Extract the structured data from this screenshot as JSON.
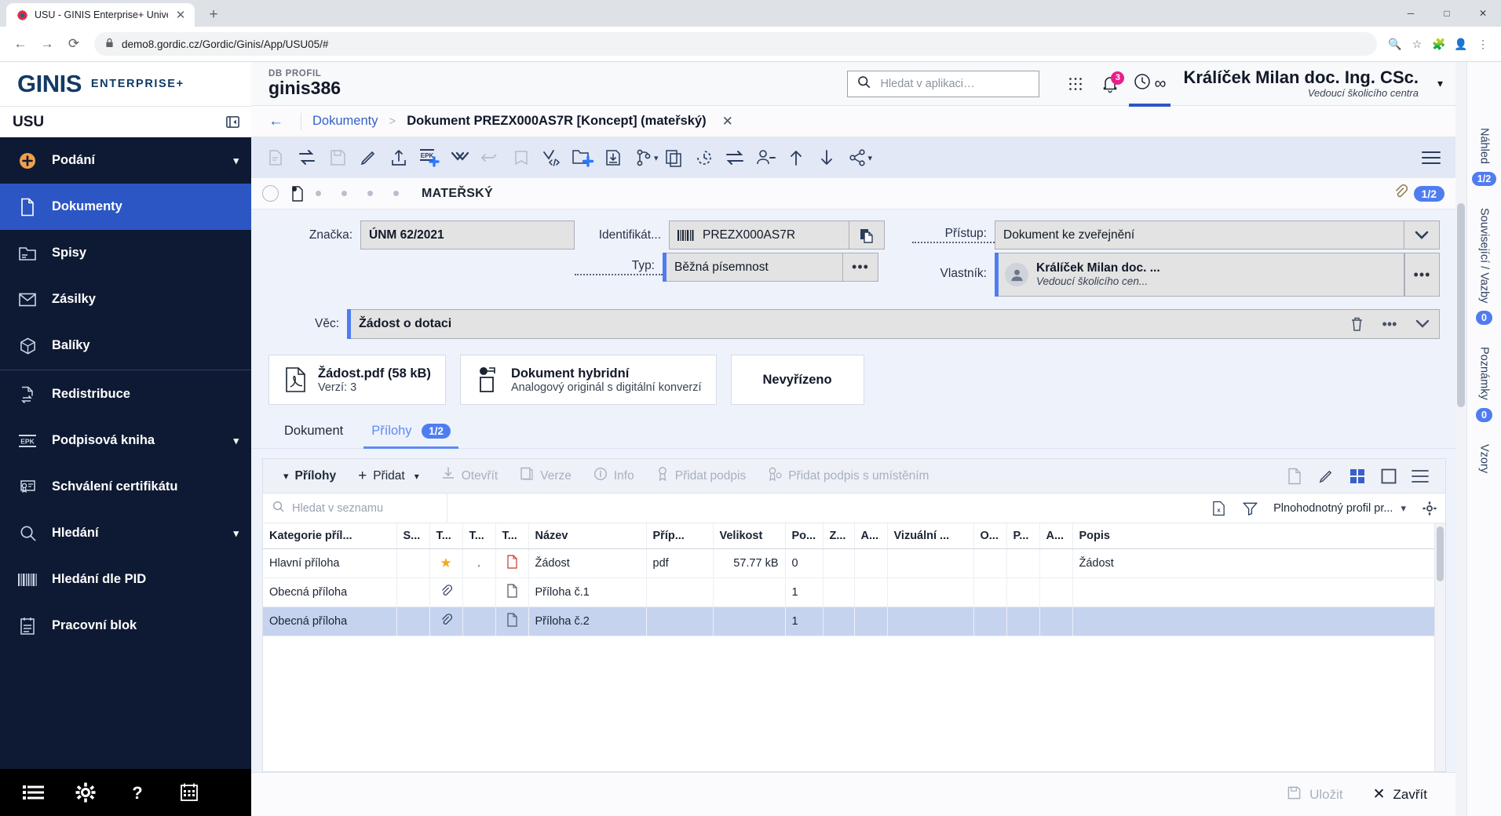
{
  "browser": {
    "tab_title": "USU - GINIS Enterprise+ Univerz",
    "new_tab_label": "+",
    "url": "demo8.gordic.cz/Gordic/Ginis/App/USU05/#",
    "minimize": "─",
    "maximize": "□",
    "close": "✕"
  },
  "sidebar": {
    "brand_primary": "GINIS",
    "brand_secondary": "ENTERPRISE+",
    "module": "USU",
    "items": [
      {
        "label": "Podání",
        "icon": "plus-circle-icon",
        "chevron": true,
        "active": false
      },
      {
        "label": "Dokumenty",
        "icon": "document-icon",
        "chevron": false,
        "active": true
      },
      {
        "label": "Spisy",
        "icon": "folder-icon",
        "chevron": false,
        "active": false
      },
      {
        "label": "Zásilky",
        "icon": "envelope-icon",
        "chevron": false,
        "active": false
      },
      {
        "label": "Balíky",
        "icon": "box-icon",
        "chevron": false,
        "active": false
      },
      {
        "label": "Redistribuce",
        "icon": "redistribute-icon",
        "chevron": false,
        "active": false
      },
      {
        "label": "Podpisová kniha",
        "icon": "epk-icon",
        "chevron": true,
        "active": false
      },
      {
        "label": "Schválení certifikátu",
        "icon": "certificate-icon",
        "chevron": false,
        "active": false
      },
      {
        "label": "Hledání",
        "icon": "search-icon",
        "chevron": true,
        "active": false
      },
      {
        "label": "Hledání dle PID",
        "icon": "barcode-icon",
        "chevron": false,
        "active": false
      },
      {
        "label": "Pracovní blok",
        "icon": "notepad-icon",
        "chevron": false,
        "active": false
      }
    ],
    "footer_icons": [
      "list-icon",
      "gear-icon",
      "help-icon",
      "calendar-icon"
    ]
  },
  "topbar": {
    "db_profile_label": "DB PROFIL",
    "db_profile_value": "ginis386",
    "search_placeholder": "Hledat v aplikaci…",
    "notifications_count": "3",
    "time_value": "∞",
    "user_name": "Králíček Milan doc. Ing. CSc.",
    "user_role": "Vedoucí školicího centra"
  },
  "breadcrumb": {
    "parent": "Dokumenty",
    "separator": ">",
    "current": "Dokument PREZX000AS7R [Koncept] (mateřský)",
    "close": "✕"
  },
  "doc_toolbar": {
    "icons": [
      "new-document-icon",
      "transfer-icon",
      "save-icon",
      "edit-pencil-icon",
      "upload-icon",
      "epk-add-icon",
      "double-check-icon",
      "forward-icon",
      "archive-box-icon",
      "check-code-icon",
      "add-folder-icon",
      "import-icon",
      "branch-icon",
      "copy-icon",
      "history-icon",
      "exchange-icon",
      "assign-person-icon",
      "arrow-up-icon",
      "arrow-down-icon",
      "share-icon",
      "menu-icon"
    ]
  },
  "status_strip": {
    "state_label": "MATEŘSKÝ",
    "attachments_badge": "1/2"
  },
  "form": {
    "znacka_label": "Značka:",
    "znacka_value": "ÚNM 62/2021",
    "identifikator_label": "Identifikát...",
    "identifikator_value": "PREZX000AS7R",
    "typ_label": "Typ:",
    "typ_value": "Běžná písemnost",
    "typ_more": "•••",
    "pristup_label": "Přístup:",
    "pristup_value": "Dokument ke zveřejnění",
    "vlastnik_label": "Vlastník:",
    "vlastnik_name": "Králíček Milan doc. ...",
    "vlastnik_role": "Vedoucí školicího cen...",
    "vlastnik_more": "•••",
    "vec_label": "Věc:",
    "vec_value": "Žádost o dotaci",
    "vec_more": "•••"
  },
  "cards": [
    {
      "title": "Žádost.pdf (58 kB)",
      "subtitle": "Verzí: 3",
      "icon": "pdf-icon"
    },
    {
      "title": "Dokument hybridní",
      "subtitle": "Analogový originál s digitální konverzí",
      "icon": "hybrid-icon"
    },
    {
      "title": "Nevyřízeno",
      "subtitle": "",
      "icon": ""
    }
  ],
  "tabs": [
    {
      "label": "Dokument",
      "badge": "",
      "active": false
    },
    {
      "label": "Přílohy",
      "badge": "1/2",
      "active": true
    }
  ],
  "attachments": {
    "section_label": "Přílohy",
    "add_label": "Přidat",
    "open_label": "Otevřít",
    "versions_label": "Verze",
    "info_label": "Info",
    "add_signature_label": "Přidat podpis",
    "add_signature_pos_label": "Přidat podpis s umístěním",
    "search_placeholder": "Hledat v seznamu",
    "profile_label": "Plnohodnotný profil pr...",
    "columns": [
      "Kategorie příl...",
      "S...",
      "T...",
      "T...",
      "T...",
      "Název",
      "Příp...",
      "Velikost",
      "Po...",
      "Z...",
      "A...",
      "Vizuální ...",
      "O...",
      "P...",
      "A...",
      "Popis"
    ],
    "rows": [
      {
        "kategorie": "Hlavní příloha",
        "s": "",
        "t1": "★",
        "t2": ".",
        "t3": "pdf-icon",
        "nazev": "Žádost",
        "pripona": "pdf",
        "velikost": "57.77 kB",
        "pocet": "0",
        "z": "",
        "a": "",
        "vizualni": "",
        "o": "",
        "p": "",
        "a2": "",
        "popis": "Žádost",
        "selected": false
      },
      {
        "kategorie": "Obecná příloha",
        "s": "",
        "t1": "📎",
        "t2": "",
        "t3": "file-icon",
        "nazev": "Příloha č.1",
        "pripona": "",
        "velikost": "",
        "pocet": "1",
        "z": "",
        "a": "",
        "vizualni": "",
        "o": "",
        "p": "",
        "a2": "",
        "popis": "",
        "selected": false
      },
      {
        "kategorie": "Obecná příloha",
        "s": "",
        "t1": "📎",
        "t2": "",
        "t3": "file-icon",
        "nazev": "Příloha č.2",
        "pripona": "",
        "velikost": "",
        "pocet": "1",
        "z": "",
        "a": "",
        "vizualni": "",
        "o": "",
        "p": "",
        "a2": "",
        "popis": "",
        "selected": true
      }
    ]
  },
  "bottom": {
    "save_label": "Uložit",
    "close_label": "Zavřít"
  },
  "right_rail": [
    {
      "label": "Náhled",
      "badge": "1/2"
    },
    {
      "label": "Související / Vazby",
      "badge": "0"
    },
    {
      "label": "Poznámky",
      "badge": "0"
    },
    {
      "label": "Vzory",
      "badge": ""
    }
  ],
  "colors": {
    "accent_blue": "#2b56c4",
    "sidebar_bg": "#0e1a33",
    "badge_pink": "#e91e8c",
    "link_blue": "#3761c7"
  }
}
